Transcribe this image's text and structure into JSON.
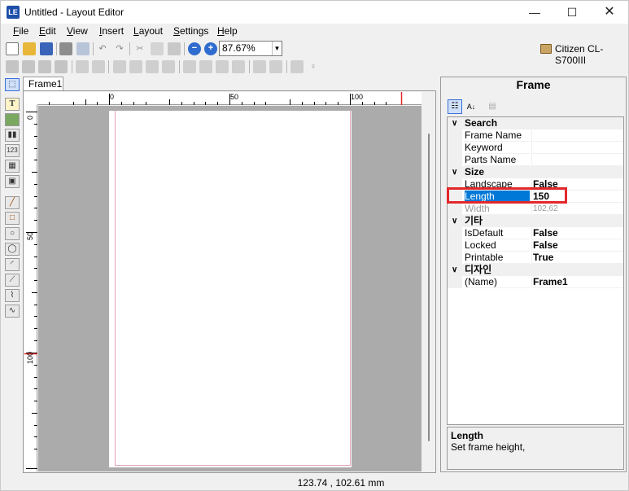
{
  "window": {
    "title": "Untitled - Layout Editor",
    "app_icon": "layout-editor-app-icon",
    "min_glyph": "—",
    "max_glyph": "☐",
    "close_glyph": "✕"
  },
  "menu": {
    "items": [
      "File",
      "Edit",
      "View",
      "Insert",
      "Layout",
      "Settings",
      "Help"
    ]
  },
  "toolbar": {
    "zoom_value": "87.67%",
    "printer_name": "Citizen CL-S700III",
    "icons": [
      "new-icon",
      "open-icon",
      "save-icon",
      "print-icon",
      "print-preview-icon",
      "undo-icon",
      "redo-icon",
      "cut-icon",
      "copy-icon",
      "paste-icon",
      "zoom-out-icon",
      "zoom-in-icon"
    ],
    "icons2": [
      "bring-front-icon",
      "send-back-icon",
      "bring-forward-icon",
      "send-backward-icon",
      "align-left-icon",
      "align-center-icon",
      "align-right-icon",
      "distribute-h-icon",
      "align-top-icon",
      "align-middle-icon",
      "align-bottom-icon",
      "distribute-v-icon",
      "same-width-icon",
      "same-height-icon",
      "lock-icon",
      "pin-icon"
    ]
  },
  "palette": {
    "tools": [
      "select-tool-icon",
      "text-tool-icon",
      "image-tool-icon",
      "barcode-tool-icon",
      "number-tool-icon",
      "qrcode-tool-icon",
      "group-tool-icon",
      "line-tool-icon",
      "rectangle-tool-icon",
      "ellipse-tool-icon",
      "circle-tool-icon",
      "arc-tool-icon",
      "diagonal-tool-icon",
      "polyline-tool-icon",
      "curve-tool-icon"
    ]
  },
  "document": {
    "tab_label": "Frame1",
    "ruler_h_labels": [
      "0",
      "50",
      "100"
    ],
    "ruler_v_labels": [
      "0",
      "50",
      "100"
    ]
  },
  "panel": {
    "title": "Frame",
    "categories": [
      {
        "label": "Search",
        "props": [
          {
            "name": "Frame Name",
            "value": ""
          },
          {
            "name": "Keyword",
            "value": ""
          },
          {
            "name": "Parts Name",
            "value": ""
          }
        ]
      },
      {
        "label": "Size",
        "props": [
          {
            "name": "Landscape",
            "value": "False"
          },
          {
            "name": "Length",
            "value": "150",
            "selected": true
          },
          {
            "name": "Width",
            "value": "102,62",
            "disabled": true
          }
        ]
      },
      {
        "label": "기타",
        "props": [
          {
            "name": "IsDefault",
            "value": "False"
          },
          {
            "name": "Locked",
            "value": "False"
          },
          {
            "name": "Printable",
            "value": "True"
          }
        ]
      },
      {
        "label": "디자인",
        "props": [
          {
            "name": "(Name)",
            "value": "Frame1"
          }
        ]
      }
    ],
    "description_title": "Length",
    "description_text": "Set frame height,"
  },
  "status": {
    "coordinates": "123.74 , 102.61 mm"
  },
  "colors": {
    "selection": "#0078d7",
    "highlight": "#e2282b",
    "canvas_bg": "#ababab",
    "ruler_marker": "#e2282b"
  }
}
